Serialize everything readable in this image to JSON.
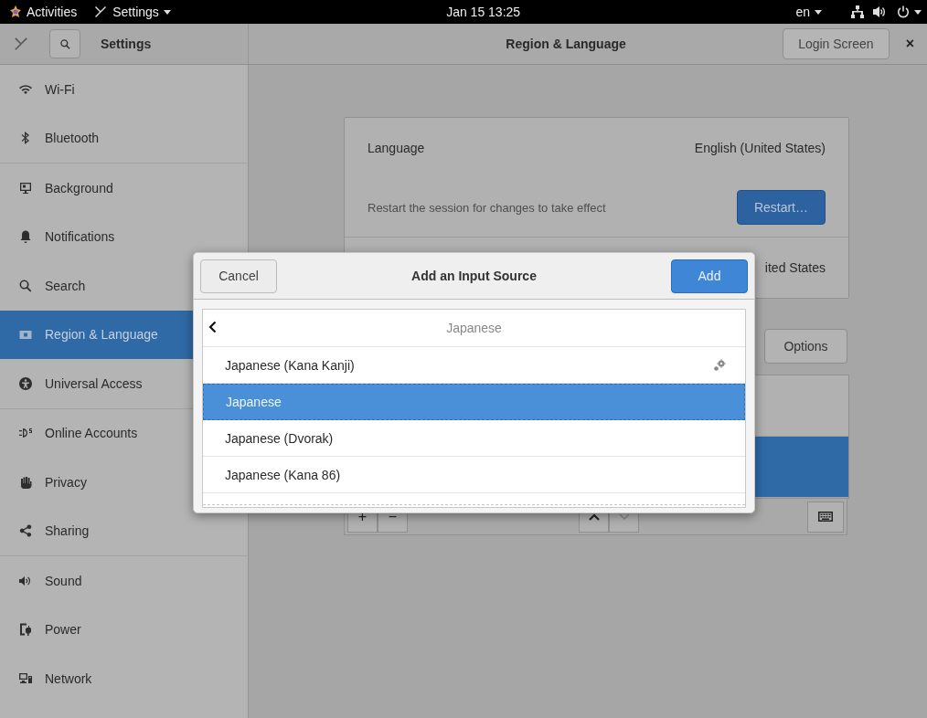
{
  "top_bar": {
    "activities": "Activities",
    "app_menu": "Settings",
    "clock": "Jan 15  13:25",
    "language": "en"
  },
  "header_bar": {
    "title": "Settings",
    "page_title": "Region & Language",
    "login_button": "Login Screen",
    "close": "×"
  },
  "sidebar": {
    "groups": [
      [
        {
          "label": "Wi-Fi",
          "selected": false
        },
        {
          "label": "Bluetooth",
          "selected": false
        }
      ],
      [
        {
          "label": "Background",
          "selected": false
        },
        {
          "label": "Notifications",
          "selected": false
        },
        {
          "label": "Search",
          "selected": false
        },
        {
          "label": "Region & Language",
          "selected": true
        },
        {
          "label": "Universal Access",
          "selected": false
        }
      ],
      [
        {
          "label": "Online Accounts",
          "selected": false
        },
        {
          "label": "Privacy",
          "selected": false
        },
        {
          "label": "Sharing",
          "selected": false
        }
      ],
      [
        {
          "label": "Sound",
          "selected": false
        },
        {
          "label": "Power",
          "selected": false
        },
        {
          "label": "Network",
          "selected": false
        }
      ]
    ]
  },
  "region_panel": {
    "language_label": "Language",
    "language_value": "English (United States)",
    "restart_note": "Restart the session for changes to take effect",
    "restart_button": "Restart…",
    "formats_value": "ited States",
    "options_button": "Options",
    "input_sources": [
      {
        "selected": false
      },
      {
        "selected": true
      }
    ],
    "add_button": "+",
    "remove_button": "−"
  },
  "dialog": {
    "cancel_button": "Cancel",
    "title": "Add an Input Source",
    "add_button": "Add",
    "list_title": "Japanese",
    "rows": [
      {
        "label": "Japanese (Kana Kanji)",
        "selected": false,
        "settings": true
      },
      {
        "label": "Japanese",
        "selected": true,
        "settings": false
      },
      {
        "label": "Japanese (Dvorak)",
        "selected": false,
        "settings": false
      },
      {
        "label": "Japanese (Kana 86)",
        "selected": false,
        "settings": false
      }
    ]
  }
}
